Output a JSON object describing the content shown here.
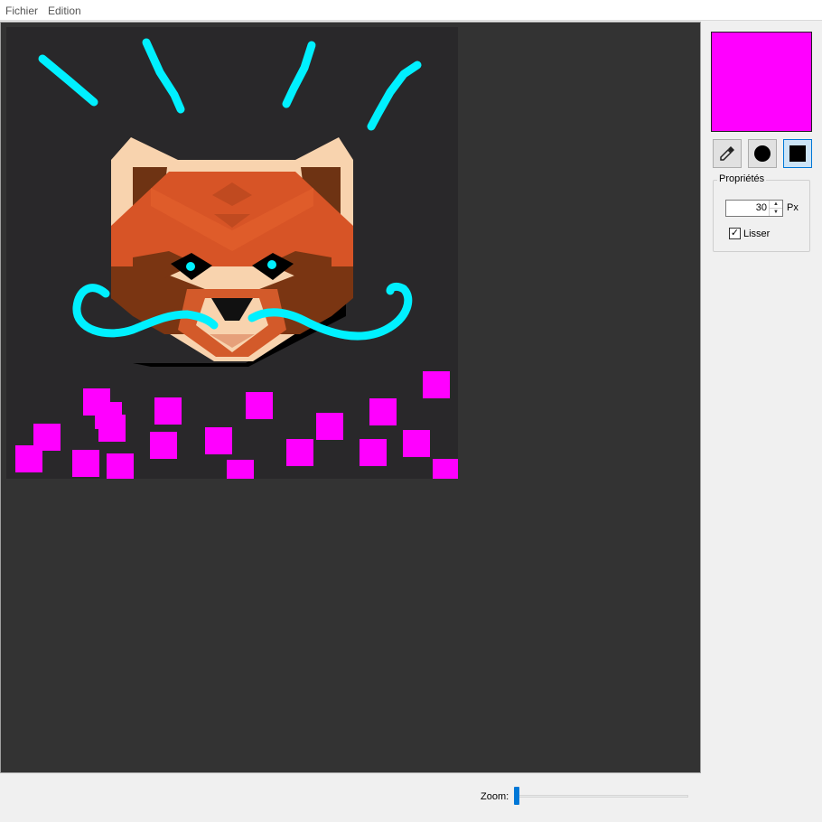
{
  "menu": {
    "file": "Fichier",
    "edit": "Edition"
  },
  "palette": {
    "current_color": "#ff00ff"
  },
  "tools": [
    {
      "name": "eyedropper-tool",
      "icon": "eyedropper-icon",
      "active": false
    },
    {
      "name": "circle-brush-tool",
      "icon": "circle-icon",
      "active": false
    },
    {
      "name": "square-brush-tool",
      "icon": "square-icon",
      "active": true
    }
  ],
  "properties": {
    "title": "Propriétés",
    "size_value": "30",
    "size_unit": "Px",
    "smooth_label": "Lisser",
    "smooth_checked": true
  },
  "zoom": {
    "label": "Zoom:",
    "level": 0.0
  },
  "colors": {
    "canvas_bg": "#333333",
    "drawing_bg": "#29282a",
    "stroke_cyan": "#00f0ff",
    "stamp_magenta": "#ff00ff",
    "accent": "#0078d7"
  }
}
